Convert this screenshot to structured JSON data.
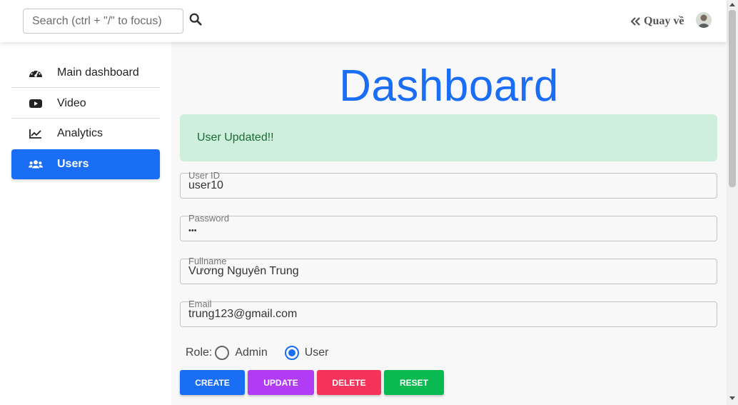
{
  "search": {
    "placeholder": "Search (ctrl + \"/\" to focus)",
    "value": ""
  },
  "header": {
    "back_label": "Quay về"
  },
  "sidebar": {
    "items": [
      {
        "label": "Main dashboard",
        "icon": "gauge-icon"
      },
      {
        "label": "Video",
        "icon": "youtube-icon"
      },
      {
        "label": "Analytics",
        "icon": "chart-line-icon"
      },
      {
        "label": "Users",
        "icon": "users-icon",
        "active": true
      }
    ]
  },
  "main": {
    "title": "Dashboard",
    "alert": "User Updated!!",
    "fields": {
      "user_id": {
        "label": "User ID",
        "value": "user10"
      },
      "password": {
        "label": "Password",
        "value": "•••"
      },
      "fullname": {
        "label": "Fullname",
        "value": "Vương Nguyên Trung"
      },
      "email": {
        "label": "Email",
        "value": "trung123@gmail.com"
      }
    },
    "role": {
      "label": "Role:",
      "options": [
        "Admin",
        "User"
      ],
      "selected": "User"
    },
    "buttons": {
      "create": "CREATE",
      "update": "UPDATE",
      "delete": "DELETE",
      "reset": "RESET"
    }
  },
  "colors": {
    "primary": "#1a6ef5",
    "create": "#1a6ef5",
    "update": "#b23cf5",
    "delete": "#f5335a",
    "reset": "#0ab94f",
    "alert_bg": "#cdefdb",
    "alert_text": "#1c6b36"
  }
}
